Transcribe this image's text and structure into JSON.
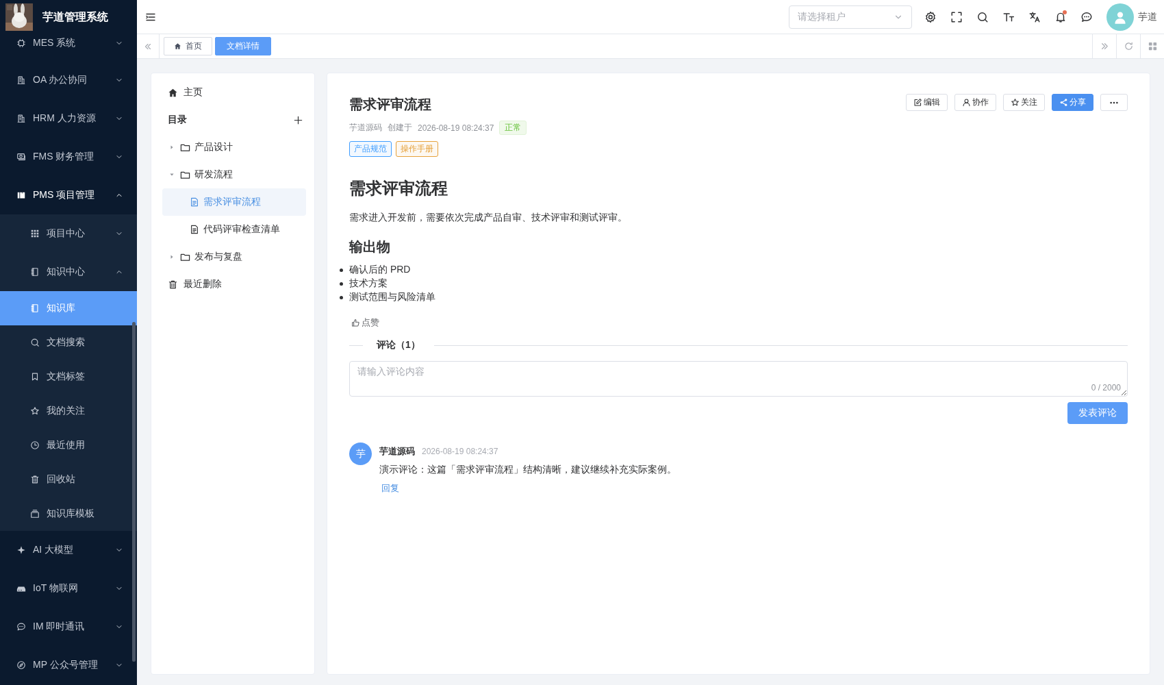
{
  "app": {
    "title": "芋道管理系统"
  },
  "sidebar": {
    "items": [
      {
        "label": "MES 系统",
        "expanded": false
      },
      {
        "label": "OA 办公协同",
        "expanded": false
      },
      {
        "label": "HRM 人力资源",
        "expanded": false
      },
      {
        "label": "FMS 财务管理",
        "expanded": false
      },
      {
        "label": "PMS 项目管理",
        "expanded": true,
        "children": [
          {
            "label": "项目中心",
            "expanded": false
          },
          {
            "label": "知识中心",
            "expanded": true,
            "children": [
              {
                "label": "知识库",
                "selected": true
              },
              {
                "label": "文档搜索",
                "selected": false
              },
              {
                "label": "文档标签",
                "selected": false
              },
              {
                "label": "我的关注",
                "selected": false
              },
              {
                "label": "最近使用",
                "selected": false
              },
              {
                "label": "回收站",
                "selected": false
              },
              {
                "label": "知识库模板",
                "selected": false
              }
            ]
          }
        ]
      },
      {
        "label": "AI 大模型",
        "expanded": false
      },
      {
        "label": "IoT 物联网",
        "expanded": false
      },
      {
        "label": "IM 即时通讯",
        "expanded": false
      },
      {
        "label": "MP 公众号管理",
        "expanded": false
      }
    ]
  },
  "header": {
    "tenant_select": {
      "placeholder": "请选择租户"
    },
    "notifications": {
      "unread": true
    },
    "user": {
      "name": "芋道"
    }
  },
  "tabs": [
    {
      "label": "首页",
      "selected": false
    },
    {
      "label": "文档详情",
      "selected": true
    }
  ],
  "tree": {
    "home": "主页",
    "catalog_title": "目录",
    "nodes": [
      {
        "kind": "folder",
        "label": "产品设计",
        "expanded": false
      },
      {
        "kind": "folder",
        "label": "研发流程",
        "expanded": true,
        "children": [
          {
            "kind": "doc",
            "label": "需求评审流程",
            "selected": true
          },
          {
            "kind": "doc",
            "label": "代码评审检查清单",
            "selected": false
          }
        ]
      },
      {
        "kind": "folder",
        "label": "发布与复盘",
        "expanded": false
      }
    ],
    "trash": "最近删除"
  },
  "document": {
    "title": "需求评审流程",
    "author": "芋道源码",
    "created_label": "创建于",
    "created_at": "2026-08-19 08:24:37",
    "status": "正常",
    "tags": [
      {
        "label": "产品规范",
        "color": "#409eff"
      },
      {
        "label": "操作手册",
        "color": "#e6a23c"
      }
    ],
    "actions": [
      {
        "kind": "edit",
        "label": "编辑"
      },
      {
        "kind": "collaborate",
        "label": "协作"
      },
      {
        "kind": "follow",
        "label": "关注"
      },
      {
        "kind": "share",
        "label": "分享"
      },
      {
        "kind": "more"
      }
    ],
    "body": [
      {
        "kind": "h1",
        "text": "需求评审流程"
      },
      {
        "kind": "p",
        "text": "需求进入开发前，需要依次完成产品自审、技术评审和测试评审。"
      },
      {
        "kind": "h2",
        "text": "输出物"
      },
      {
        "kind": "ul",
        "items": [
          "确认后的 PRD",
          "技术方案",
          "测试范围与风险清单"
        ]
      }
    ],
    "like": "点赞",
    "comments_title": "评论（1）",
    "comment_input": {
      "placeholder": "请输入评论内容",
      "counter": "0 / 2000"
    },
    "submit": "发表评论",
    "comments": [
      {
        "avatar": "芋",
        "author": "芋道源码",
        "time": "2026-08-19 08:24:37",
        "text": "演示评论：这篇「需求评审流程」结构清晰，建议继续补充实际案例。",
        "reply": "回复"
      }
    ]
  }
}
